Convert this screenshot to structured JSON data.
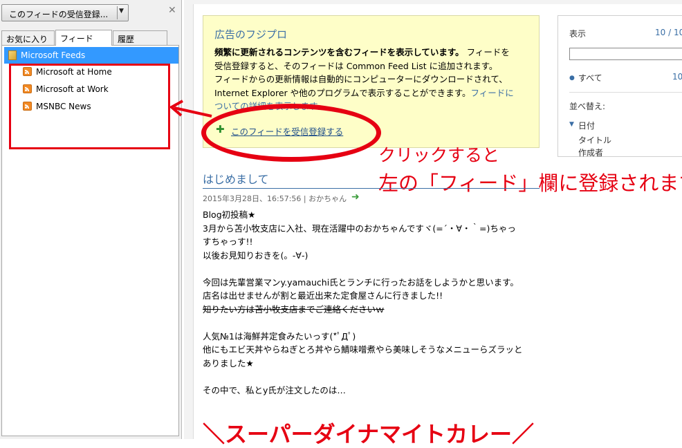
{
  "left_pane": {
    "subscribe_combo_label": "このフィードの受信登録...",
    "tabs": [
      {
        "label": "お気に入り"
      },
      {
        "label": "フィード"
      },
      {
        "label": "履歴"
      }
    ],
    "tree": {
      "root_label": "Microsoft Feeds",
      "items": [
        {
          "label": "Microsoft at Home"
        },
        {
          "label": "Microsoft at Work"
        },
        {
          "label": "MSNBC News"
        }
      ]
    }
  },
  "info_box": {
    "title": "広告のフジプロ",
    "bold_text": "頻繁に更新されるコンテンツを含むフィードを表示しています。",
    "text_after_bold": " フィードを",
    "line2": "受信登録すると、そのフィードは Common Feed List に追加されます。",
    "line3": "フィードからの更新情報は自動的にコンピューターにダウンロードされて、",
    "line4_text": "Internet Explorer や他のプログラムで表示することができます。",
    "line4_link": "フィードに",
    "line5_link": "ついての詳細を表示します。",
    "subscribe_link": "このフィードを受信登録する"
  },
  "side_panel": {
    "display_label": "表示",
    "display_count": "10 / 10",
    "all_label": "すべて",
    "all_count": "10",
    "sort_label": "並べ替え:",
    "sort_options": [
      {
        "label": "日付"
      },
      {
        "label": "タイトル"
      },
      {
        "label": "作成者"
      }
    ]
  },
  "annotations": {
    "line1": "クリックすると",
    "line2": "左の「フィード」欄に登録されます"
  },
  "post": {
    "title": "はじめまして",
    "meta": "2015年3月28日、16:57:56 | おかちゃん",
    "lines": [
      "Blog初投稿★",
      "3月から苫小牧支店に入社、現在活躍中のおかちゃんですヾ(=´・∀・｀=)ちゃっ",
      "すちゃっす!!",
      "以後お見知りおきを(。-∀-)",
      "",
      "今回は先輩営業マンy.yamauchi氏とランチに行ったお話をしようかと思います。",
      "店名は出せませんが割と最近出来た定食屋さんに行きました!!",
      "知りたい方は苫小牧支店までご連絡くださいｗ",
      "",
      "人気№1は海鮮丼定食みたいっす(*ﾟДﾟ)",
      "他にもエビ天丼やらねぎとろ丼やら鯖味噌煮やら美味しそうなメニューらズラッと",
      "ありました★",
      "",
      "その中で、私とy氏が注文したのは…"
    ],
    "bottom_text": "＼スーパーダイナマイトカレー／"
  }
}
